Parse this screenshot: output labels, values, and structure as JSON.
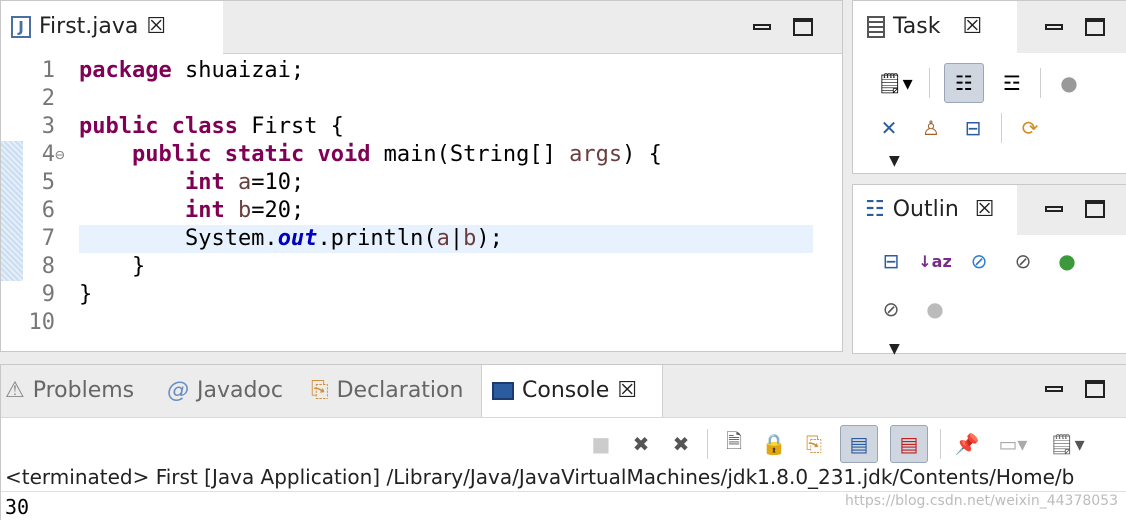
{
  "editor": {
    "tab_label": "First.java",
    "lines": [
      {
        "num": "1",
        "parts": [
          {
            "t": "package",
            "c": "kw"
          },
          {
            "t": " shuaizai;"
          }
        ]
      },
      {
        "num": "2",
        "parts": []
      },
      {
        "num": "3",
        "parts": [
          {
            "t": "public",
            "c": "kw"
          },
          {
            "t": " "
          },
          {
            "t": "class",
            "c": "kw"
          },
          {
            "t": " First {"
          }
        ]
      },
      {
        "num": "4",
        "parts": [
          {
            "t": "    "
          },
          {
            "t": "public",
            "c": "kw"
          },
          {
            "t": " "
          },
          {
            "t": "static",
            "c": "kw"
          },
          {
            "t": " "
          },
          {
            "t": "void",
            "c": "kw"
          },
          {
            "t": " main(String[] "
          },
          {
            "t": "args",
            "c": "var"
          },
          {
            "t": ") {"
          }
        ]
      },
      {
        "num": "5",
        "parts": [
          {
            "t": "        "
          },
          {
            "t": "int",
            "c": "kw"
          },
          {
            "t": " "
          },
          {
            "t": "a",
            "c": "var"
          },
          {
            "t": "=10;"
          }
        ]
      },
      {
        "num": "6",
        "parts": [
          {
            "t": "        "
          },
          {
            "t": "int",
            "c": "kw"
          },
          {
            "t": " "
          },
          {
            "t": "b",
            "c": "var"
          },
          {
            "t": "=20;"
          }
        ]
      },
      {
        "num": "7",
        "parts": [
          {
            "t": "        System."
          },
          {
            "t": "out",
            "c": "fld"
          },
          {
            "t": ".println("
          },
          {
            "t": "a",
            "c": "var"
          },
          {
            "t": "|"
          },
          {
            "t": "b",
            "c": "var"
          },
          {
            "t": ");"
          }
        ]
      },
      {
        "num": "8",
        "parts": [
          {
            "t": "    }"
          }
        ]
      },
      {
        "num": "9",
        "parts": [
          {
            "t": "}"
          }
        ]
      },
      {
        "num": "10",
        "parts": []
      }
    ]
  },
  "task_view": {
    "tab_label": "Task"
  },
  "outline_view": {
    "tab_label": "Outlin"
  },
  "bottom": {
    "tabs": [
      {
        "label": "Problems",
        "active": false
      },
      {
        "label": "Javadoc",
        "active": false
      },
      {
        "label": "Declaration",
        "active": false
      },
      {
        "label": "Console",
        "active": true
      }
    ],
    "status": "<terminated> First [Java Application] /Library/Java/JavaVirtualMachines/jdk1.8.0_231.jdk/Contents/Home/b",
    "output": "30",
    "watermark": "https://blog.csdn.net/weixin_44378053"
  },
  "colors": {
    "keyword": "#7f0055",
    "field": "#0000c0",
    "variable": "#6a3e3e",
    "highlight": "#e8f2fe"
  }
}
